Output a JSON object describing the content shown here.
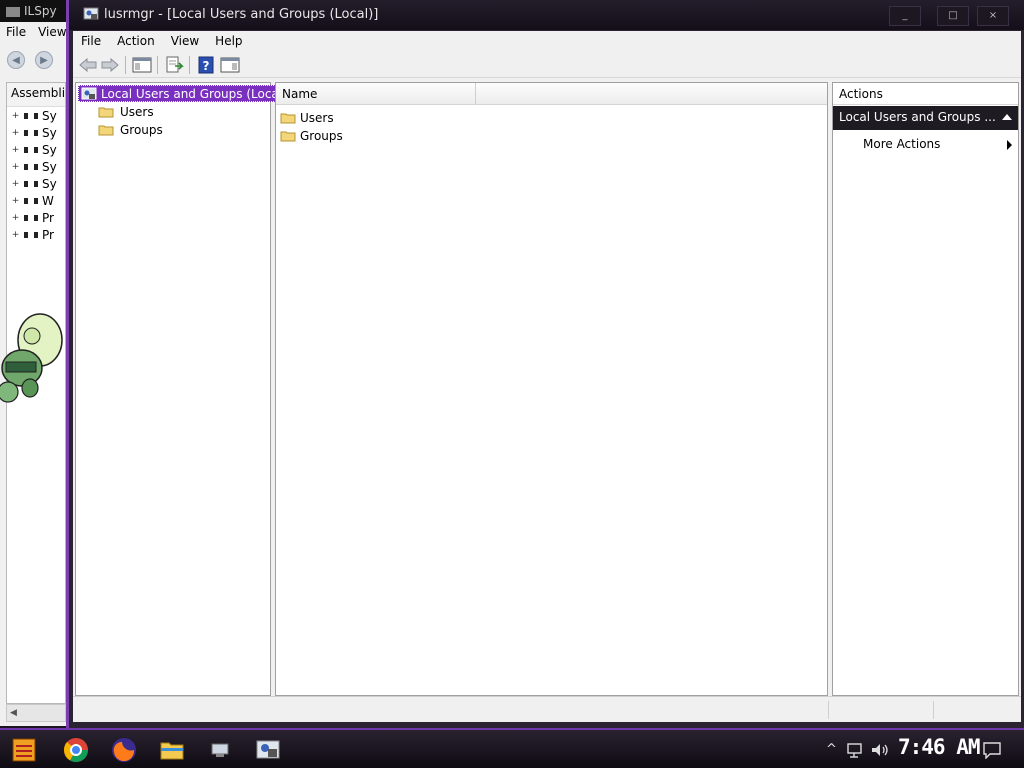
{
  "background_window": {
    "title": "ILSpy",
    "menu": [
      "File",
      "View"
    ],
    "list_header": "Assemblies",
    "rows": [
      {
        "expander": "+",
        "label": "Sy"
      },
      {
        "expander": "+",
        "label": "Sy"
      },
      {
        "expander": "+",
        "label": "Sy"
      },
      {
        "expander": "+",
        "label": "Sy"
      },
      {
        "expander": "+",
        "label": "Sy"
      },
      {
        "expander": "+",
        "label": "W"
      },
      {
        "expander": "+",
        "label": "Pr"
      },
      {
        "expander": "+",
        "label": "Pr"
      }
    ]
  },
  "window": {
    "title": "lusrmgr - [Local Users and Groups (Local)]",
    "minimize": "_",
    "maximize": "□",
    "close": "×"
  },
  "menu": {
    "file": "File",
    "action": "Action",
    "view": "View",
    "help": "Help"
  },
  "tree": {
    "root": "Local Users and Groups (Local)",
    "children": [
      "Users",
      "Groups"
    ]
  },
  "list": {
    "column_name": "Name",
    "items": [
      "Users",
      "Groups"
    ]
  },
  "actions": {
    "header": "Actions",
    "section": "Local Users and Groups ...",
    "more_actions": "More Actions"
  },
  "taskbar": {
    "clock": "7:46 AM"
  },
  "colors": {
    "accent_purple": "#7a2fc0",
    "action_section_bg": "#1f1b23"
  }
}
